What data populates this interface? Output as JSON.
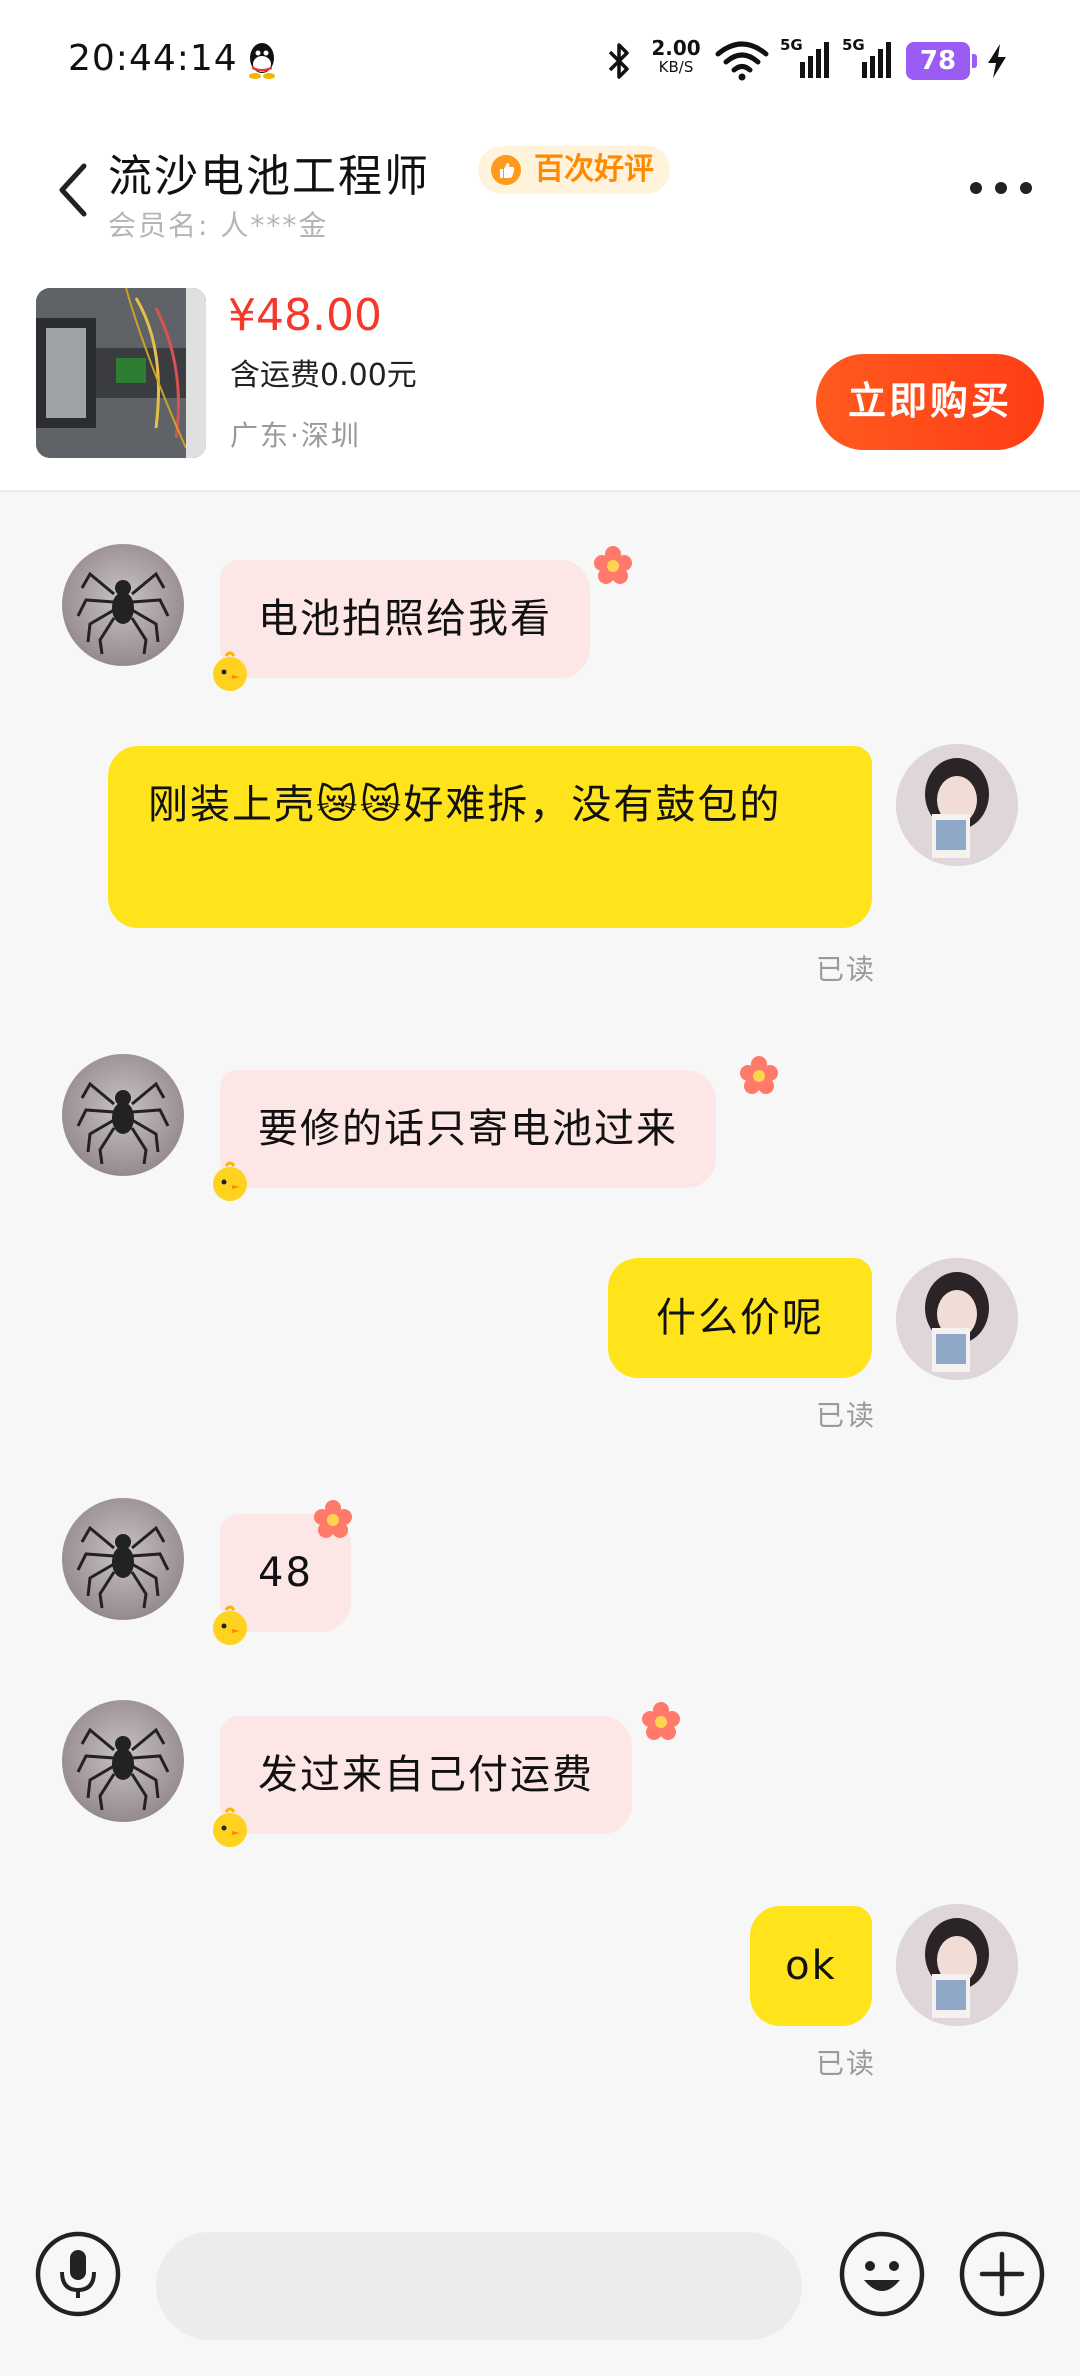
{
  "status_bar": {
    "time": "20:44:14",
    "net_speed_value": "2.00",
    "net_speed_unit": "KB/S",
    "signal1_label": "5G",
    "signal2_label": "5G",
    "battery_level": "78",
    "icons": [
      "qq-icon",
      "bluetooth-icon",
      "wifi-icon",
      "signal-icon",
      "signal-icon",
      "battery-icon",
      "charging-icon"
    ]
  },
  "header": {
    "seller_name": "流沙电池工程师",
    "rating_badge": "百次好评",
    "member_name": "会员名: 人***金"
  },
  "product": {
    "price": "¥48.00",
    "shipping": "含运费0.00元",
    "location": "广东·深圳",
    "buy_label": "立即购买"
  },
  "messages": [
    {
      "side": "in",
      "text": "电池拍照给我看"
    },
    {
      "side": "out",
      "text": "刚装上壳😿😿好难拆，没有鼓包的",
      "status": "已读"
    },
    {
      "side": "in",
      "text": "要修的话只寄电池过来"
    },
    {
      "side": "out",
      "text": "什么价呢",
      "status": "已读"
    },
    {
      "side": "in",
      "text": "48"
    },
    {
      "side": "in",
      "text": "发过来自己付运费"
    },
    {
      "side": "out",
      "text": "ok",
      "status": "已读"
    }
  ],
  "input_bar": {
    "placeholder": "",
    "icons": [
      "microphone-icon",
      "emoji-icon",
      "plus-icon"
    ]
  },
  "colors": {
    "outgoing_bubble": "#ffe41c",
    "incoming_bubble": "#fde7e6",
    "buy_button": "#ff4b1a",
    "price": "#f2392b",
    "badge": "#ff8a00",
    "battery": "#9b5cf6"
  }
}
